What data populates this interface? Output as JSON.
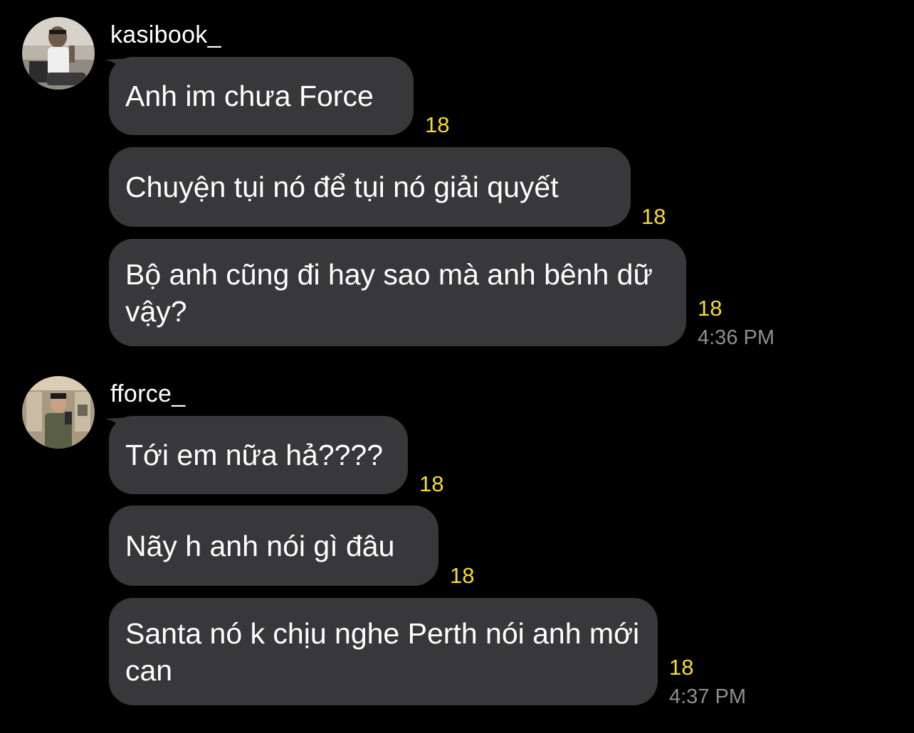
{
  "colors": {
    "background": "#000000",
    "bubble": "#38383a",
    "count": "#f7dd29",
    "time": "#8e8e93",
    "text": "#ffffff"
  },
  "groups": [
    {
      "sender": "kasibook_",
      "avatar_icon": "profile-photo",
      "messages": [
        {
          "text": "Anh im chưa Force",
          "count": "18"
        },
        {
          "text": "Chuyện tụi nó để tụi nó giải quyết",
          "count": "18"
        },
        {
          "text": "Bộ anh cũng đi hay sao mà anh bênh dữ vậy?",
          "count": "18",
          "time": "4:36 PM"
        }
      ]
    },
    {
      "sender": "fforce_",
      "avatar_icon": "profile-photo",
      "messages": [
        {
          "text": "Tới em nữa hả????",
          "count": "18"
        },
        {
          "text": "Nãy h anh nói gì đâu",
          "count": "18"
        },
        {
          "text": "Santa nó k chịu nghe Perth nói anh mới can",
          "count": "18",
          "time": "4:37 PM"
        }
      ]
    }
  ]
}
